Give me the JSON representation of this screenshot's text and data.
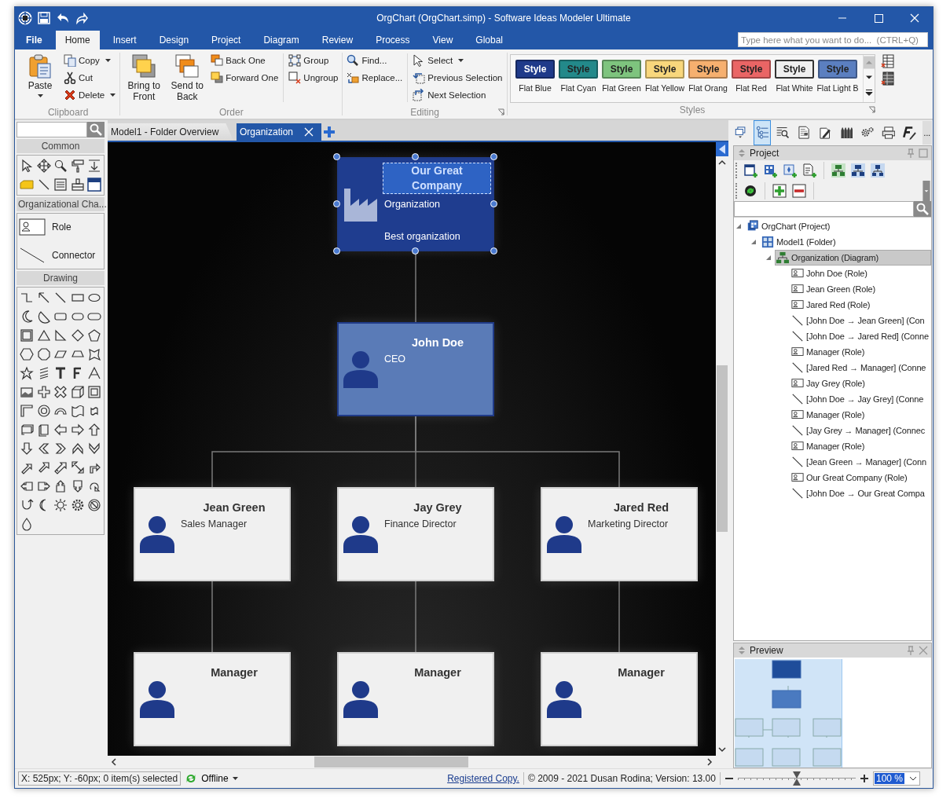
{
  "window": {
    "title": "OrgChart (OrgChart.simp) - Software Ideas Modeler Ultimate"
  },
  "ribbon_tabs": [
    {
      "label": "File",
      "selected": false
    },
    {
      "label": "Home",
      "selected": true
    },
    {
      "label": "Insert",
      "selected": false
    },
    {
      "label": "Design",
      "selected": false
    },
    {
      "label": "Project",
      "selected": false
    },
    {
      "label": "Diagram",
      "selected": false
    },
    {
      "label": "Review",
      "selected": false
    },
    {
      "label": "Process",
      "selected": false
    },
    {
      "label": "View",
      "selected": false
    },
    {
      "label": "Global",
      "selected": false
    }
  ],
  "command_search": {
    "placeholder": "Type here what you want to do...  (CTRL+Q)"
  },
  "ribbon_groups": [
    {
      "label": "Clipboard",
      "sections": [
        [
          [
            {
              "kind": "large",
              "label": "Paste",
              "dropdown": true
            }
          ],
          [
            {
              "kind": "small",
              "label": "Copy",
              "dropdown": true
            },
            {
              "kind": "small",
              "label": "Cut",
              "dropdown": false
            },
            {
              "kind": "small",
              "label": "Delete",
              "dropdown": true
            }
          ]
        ]
      ]
    },
    {
      "label": "Order",
      "sections": [
        [
          [
            {
              "kind": "large",
              "label": "Bring to Front",
              "dropdown": false
            }
          ],
          [
            {
              "kind": "large",
              "label": "Send to Back",
              "dropdown": false
            }
          ],
          [
            {
              "kind": "small",
              "label": "Back One",
              "dropdown": false
            },
            {
              "kind": "small",
              "label": "Forward One",
              "dropdown": false
            }
          ]
        ],
        [
          [
            {
              "kind": "small",
              "label": "Group",
              "dropdown": false
            },
            {
              "kind": "small",
              "label": "Ungroup",
              "dropdown": false
            }
          ]
        ]
      ]
    },
    {
      "label": "Editing",
      "sections": [
        [
          [
            {
              "kind": "small",
              "label": "Find...",
              "dropdown": false
            },
            {
              "kind": "small",
              "label": "Replace...",
              "dropdown": false
            }
          ]
        ],
        [
          [
            {
              "kind": "small",
              "label": "Select",
              "dropdown": true
            },
            {
              "kind": "small",
              "label": "Previous Selection",
              "dropdown": false
            },
            {
              "kind": "small",
              "label": "Next Selection",
              "dropdown": false
            }
          ]
        ]
      ]
    }
  ],
  "styles": {
    "label": "Styles",
    "items": [
      {
        "button": "Style",
        "name": "Flat Blue",
        "color": "#1f3a8a"
      },
      {
        "button": "Style",
        "name": "Flat Cyan",
        "color": "#23898a"
      },
      {
        "button": "Style",
        "name": "Flat Green",
        "color": "#7ec47e"
      },
      {
        "button": "Style",
        "name": "Flat Yellow",
        "color": "#f8d77c"
      },
      {
        "button": "Style",
        "name": "Flat Orang",
        "color": "#f6b06f"
      },
      {
        "button": "Style",
        "name": "Flat Red",
        "color": "#ea6565"
      },
      {
        "button": "Style",
        "name": "Flat White",
        "color": "#efefef"
      },
      {
        "button": "Style",
        "name": "Flat Light B",
        "color": "#5b7fc0"
      }
    ]
  },
  "toolbox": {
    "sections": [
      {
        "kind": "icons",
        "title": "Common"
      },
      {
        "kind": "list",
        "title": "Organizational Cha...",
        "items": [
          "Role",
          "Connector"
        ]
      },
      {
        "kind": "icons",
        "title": "Drawing"
      }
    ]
  },
  "document_tabs": [
    {
      "label": "Model1 - Folder Overview",
      "selected": false
    },
    {
      "label": "Organization",
      "selected": true
    }
  ],
  "canvas": {
    "nodes": [
      {
        "kind": "organization",
        "title": "Our Great Company",
        "subtitle": "Organization",
        "note": "Best organization",
        "color": "#1f3d8f",
        "selected": true,
        "children": [
          {
            "kind": "role",
            "title": "John Doe",
            "subtitle": "CEO",
            "color": "#5a7bb7",
            "selected": false,
            "children": [
              {
                "kind": "role",
                "title": "Jean Green",
                "subtitle": "Sales Manager",
                "color": "#f0f0f0",
                "selected": false,
                "children": [
                  {
                    "kind": "role",
                    "title": "Manager",
                    "color": "#f0f0f0",
                    "selected": false
                  }
                ]
              },
              {
                "kind": "role",
                "title": "Jay Grey",
                "subtitle": "Finance Director",
                "color": "#f0f0f0",
                "selected": false,
                "children": [
                  {
                    "kind": "role",
                    "title": "Manager",
                    "color": "#f0f0f0",
                    "selected": false
                  }
                ]
              },
              {
                "kind": "role",
                "title": "Jared Red",
                "subtitle": "Marketing Director",
                "color": "#f0f0f0",
                "selected": false,
                "children": [
                  {
                    "kind": "role",
                    "title": "Manager",
                    "color": "#f0f0f0",
                    "selected": false
                  }
                ]
              }
            ]
          }
        ]
      }
    ]
  },
  "panel_toolbar": {
    "overflow": "..."
  },
  "project_panel": {
    "title": "Project",
    "tree": [
      {
        "kind": "project",
        "label": "OrgChart (Project)",
        "selected": false,
        "expanded": true,
        "children": [
          {
            "kind": "folder",
            "label": "Model1 (Folder)",
            "selected": false,
            "expanded": true,
            "children": [
              {
                "kind": "diagram",
                "label": "Organization (Diagram)",
                "selected": true,
                "expanded": true,
                "children": [
                  {
                    "kind": "role",
                    "label": "John Doe (Role)",
                    "selected": false
                  },
                  {
                    "kind": "role",
                    "label": "Jean Green (Role)",
                    "selected": false
                  },
                  {
                    "kind": "role",
                    "label": "Jared Red (Role)",
                    "selected": false
                  },
                  {
                    "kind": "connector",
                    "label": "[John Doe → Jean Green] (Con",
                    "selected": false
                  },
                  {
                    "kind": "connector",
                    "label": "[John Doe → Jared Red] (Conne",
                    "selected": false
                  },
                  {
                    "kind": "role",
                    "label": "Manager (Role)",
                    "selected": false
                  },
                  {
                    "kind": "connector",
                    "label": "[Jared Red → Manager] (Conne",
                    "selected": false
                  },
                  {
                    "kind": "role",
                    "label": "Jay Grey (Role)",
                    "selected": false
                  },
                  {
                    "kind": "connector",
                    "label": "[John Doe → Jay Grey] (Conne",
                    "selected": false
                  },
                  {
                    "kind": "role",
                    "label": "Manager (Role)",
                    "selected": false
                  },
                  {
                    "kind": "connector",
                    "label": "[Jay Grey → Manager] (Connec",
                    "selected": false
                  },
                  {
                    "kind": "role",
                    "label": "Manager (Role)",
                    "selected": false
                  },
                  {
                    "kind": "connector",
                    "label": "[Jean Green → Manager] (Conn",
                    "selected": false
                  },
                  {
                    "kind": "role",
                    "label": "Our Great Company (Role)",
                    "selected": false
                  },
                  {
                    "kind": "connector",
                    "label": "[John Doe → Our Great Compa",
                    "selected": false
                  }
                ]
              }
            ]
          }
        ]
      }
    ]
  },
  "preview_panel": {
    "title": "Preview"
  },
  "status_bar": {
    "position": "X: 525px; Y: -60px; 0 item(s) selected",
    "connection": "Offline",
    "link": "Registered Copy.",
    "copyright": "© 2009 - 2021 Dusan Rodina; Version: 13.00",
    "zoom": {
      "level": 0.5,
      "value": "100 %"
    }
  }
}
